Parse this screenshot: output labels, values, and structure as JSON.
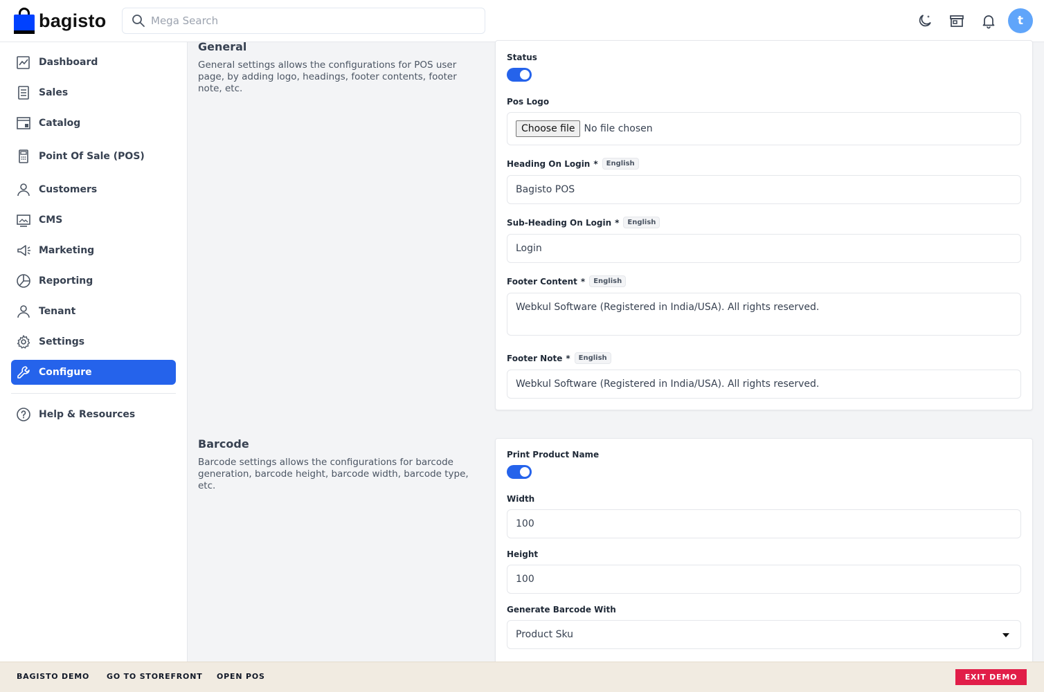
{
  "header": {
    "logo_text": "bagisto",
    "search_placeholder": "Mega Search",
    "avatar_initial": "t"
  },
  "sidebar": {
    "items": [
      {
        "label": "Dashboard",
        "icon": "dashboard-icon"
      },
      {
        "label": "Sales",
        "icon": "sales-icon"
      },
      {
        "label": "Catalog",
        "icon": "catalog-icon"
      },
      {
        "label": "Point Of Sale (POS)",
        "icon": "pos-icon"
      },
      {
        "label": "Customers",
        "icon": "customers-icon"
      },
      {
        "label": "CMS",
        "icon": "cms-icon"
      },
      {
        "label": "Marketing",
        "icon": "megaphone-icon"
      },
      {
        "label": "Reporting",
        "icon": "pie-chart-icon"
      },
      {
        "label": "Tenant",
        "icon": "user-icon"
      },
      {
        "label": "Settings",
        "icon": "gear-icon"
      },
      {
        "label": "Configure",
        "icon": "wrench-icon"
      },
      {
        "label": "Help & Resources",
        "icon": "help-icon"
      }
    ],
    "active_color": "#2563eb"
  },
  "general": {
    "title": "General",
    "description": "General settings allows the configurations for POS user page, by adding logo, headings, footer contents, footer note, etc.",
    "status_label": "Status",
    "status_on": true,
    "pos_logo_label": "Pos Logo",
    "choose_file": "Choose file",
    "no_file": "No file chosen",
    "heading_label": "Heading On Login",
    "heading_value": "Bagisto POS",
    "subheading_label": "Sub-Heading On Login",
    "subheading_value": "Login",
    "footer_content_label": "Footer Content",
    "footer_content_value": "Webkul Software (Registered in India/USA). All rights reserved.",
    "footer_note_label": "Footer Note",
    "footer_note_value": "Webkul Software (Registered in India/USA). All rights reserved.",
    "required_mark": "*",
    "locale_badge": "English"
  },
  "barcode": {
    "title": "Barcode",
    "description": "Barcode settings allows the configurations for barcode generation, barcode height, barcode width, barcode type, etc.",
    "print_name_label": "Print Product Name",
    "print_name_on": true,
    "width_label": "Width",
    "width_value": "100",
    "height_label": "Height",
    "height_value": "100",
    "generate_label": "Generate Barcode With",
    "generate_value": "Product Sku"
  },
  "footer": {
    "demo": "BAGISTO DEMO",
    "storefront": "GO TO STOREFRONT",
    "open_pos": "OPEN POS",
    "exit": "EXIT DEMO"
  }
}
